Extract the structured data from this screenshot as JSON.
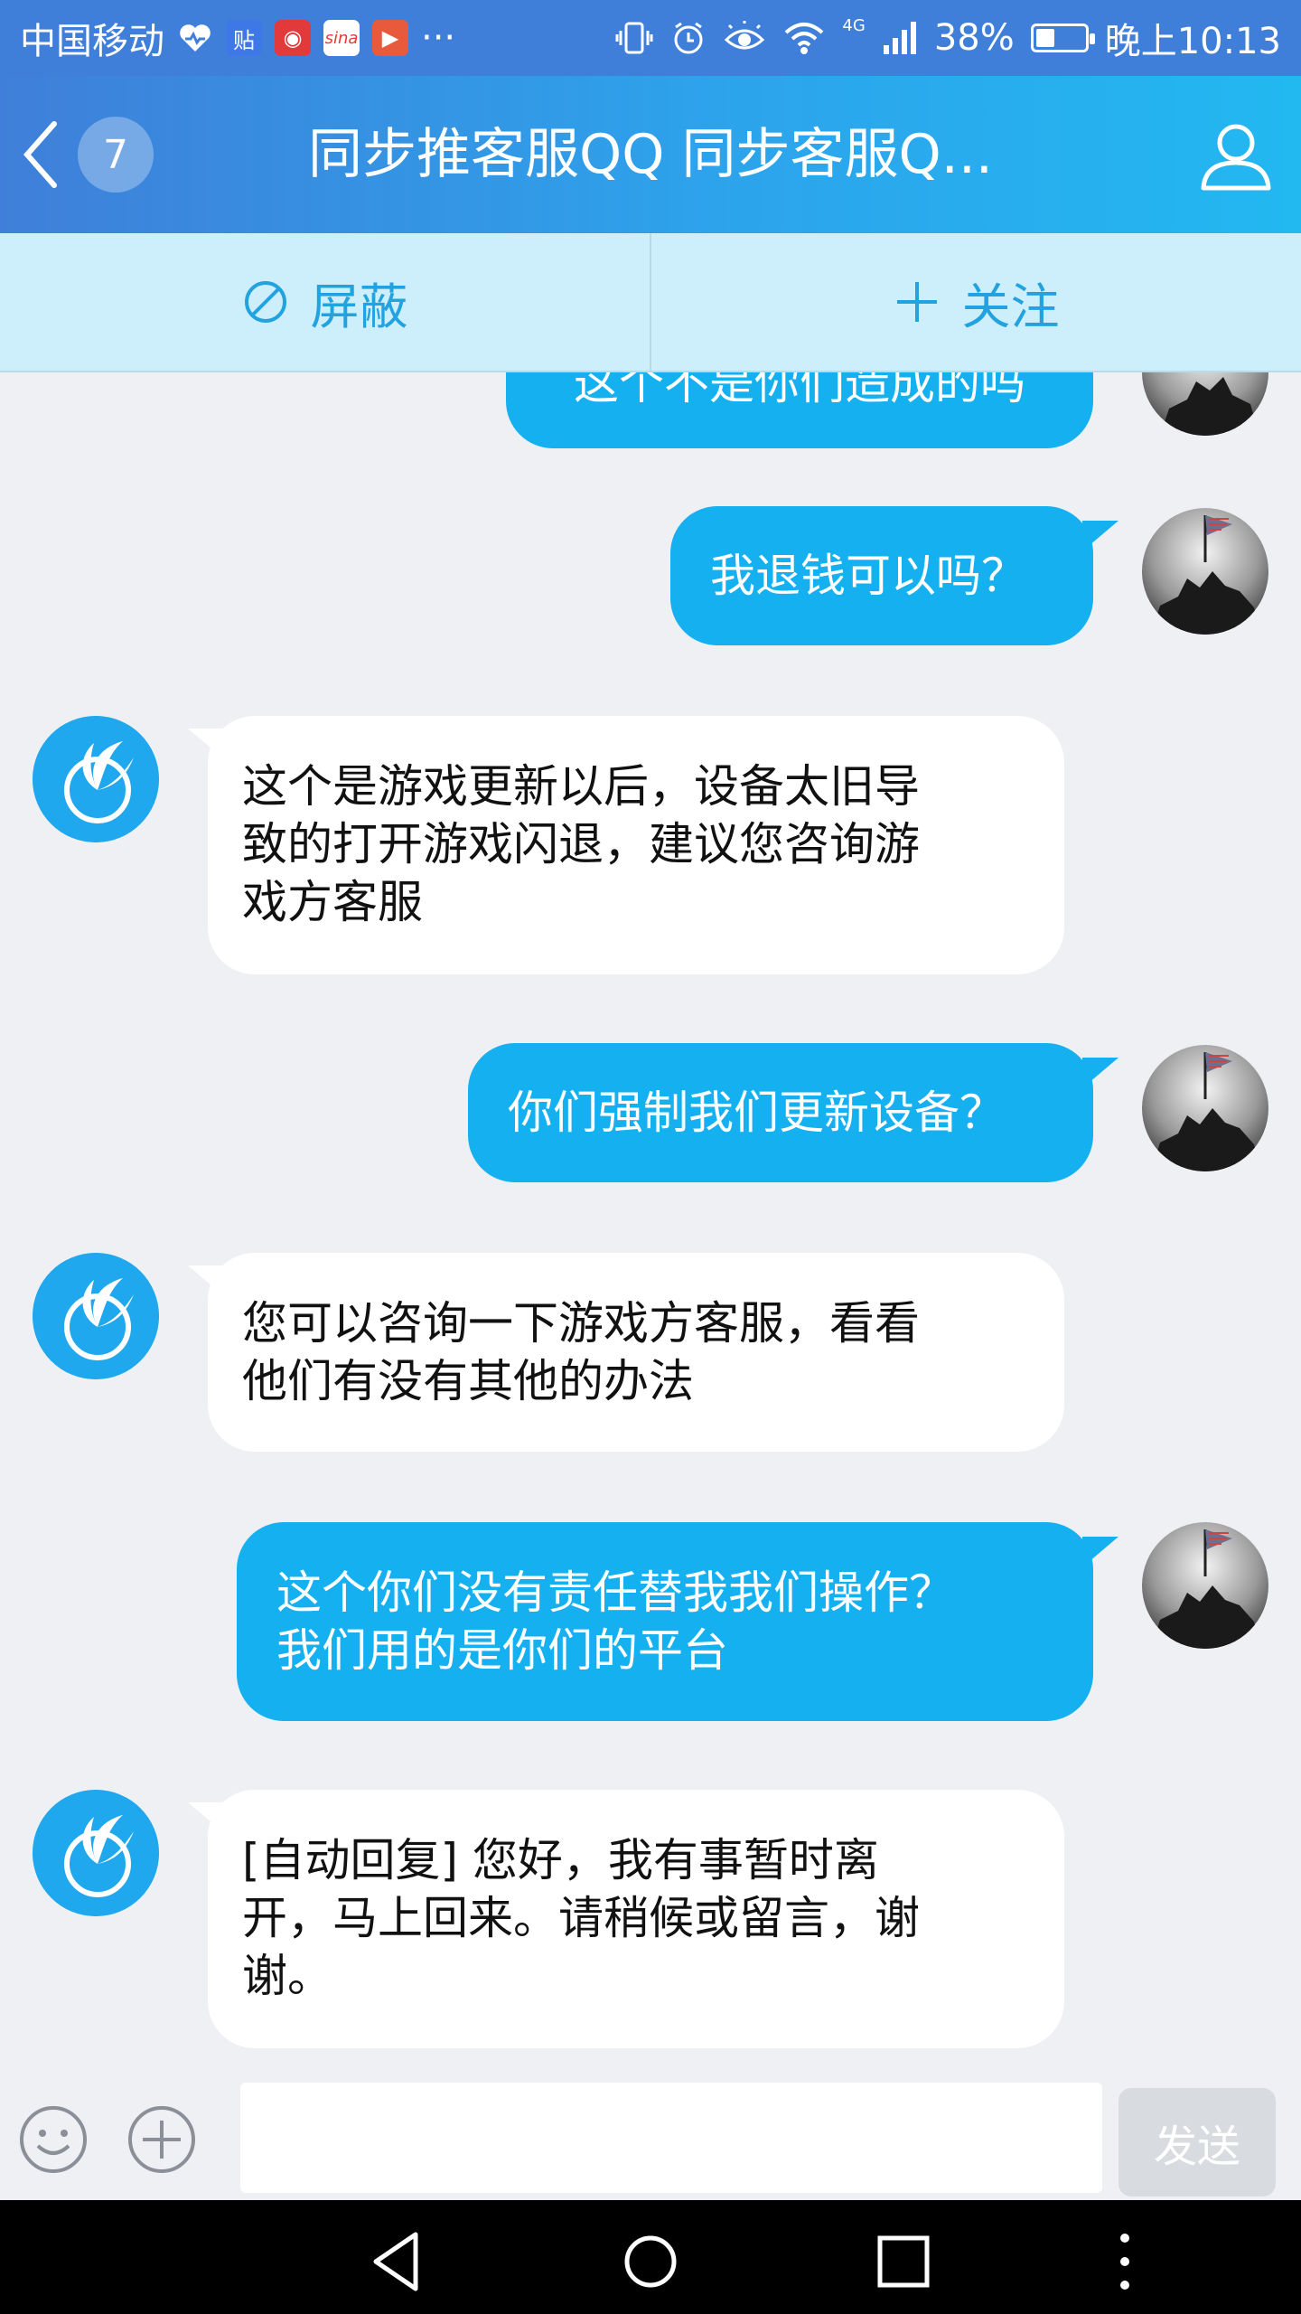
{
  "status_bar": {
    "carrier": "中国移动",
    "apps": [
      {
        "icon": "health-heart-icon",
        "text": "",
        "color": "transparent"
      },
      {
        "icon": "tieba-app-icon",
        "text": "贴",
        "color": "#3e78e6"
      },
      {
        "icon": "weibo-app-icon",
        "text": "◉",
        "color": "#e23a3a"
      },
      {
        "icon": "sina-app-icon",
        "text": "sina",
        "color": "#e63a2e"
      },
      {
        "icon": "video-app-icon",
        "text": "▶",
        "color": "#e85a3c"
      }
    ],
    "more": "···",
    "battery_percent": "38%",
    "battery_level": 0.38,
    "network": "4G",
    "time": "晚上10:13"
  },
  "header": {
    "unread_count": "7",
    "title": "同步推客服QQ 同步客服Q..."
  },
  "actions": {
    "block_label": "屏蔽",
    "follow_label": "关注"
  },
  "messages": [
    {
      "side": "out",
      "text": "这个不是你们造成的吗"
    },
    {
      "side": "out",
      "text": "我退钱可以吗？"
    },
    {
      "side": "in",
      "lines": [
        "这个是游戏更新以后，设备太旧导",
        "致的打开游戏闪退，建议您咨询游",
        "戏方客服"
      ]
    },
    {
      "side": "out",
      "text": "你们强制我们更新设备？"
    },
    {
      "side": "in",
      "lines": [
        "您可以咨询一下游戏方客服，看看",
        "他们有没有其他的办法"
      ]
    },
    {
      "side": "out",
      "lines": [
        "这个你们没有责任替我我们操作？",
        "我们用的是你们的平台"
      ]
    },
    {
      "side": "in",
      "lines": [
        "[自动回复] 您好，我有事暂时离",
        "开，马上回来。请稍候或留言，谢",
        "谢。"
      ]
    }
  ],
  "composer": {
    "value": "",
    "send_label": "发送"
  },
  "colors": {
    "outgoing_bubble": "#15b0f0",
    "incoming_bubble": "#ffffff",
    "header_start": "#3f7fd9",
    "header_end": "#22b8f0",
    "action_bar": "#cdeffb",
    "action_text": "#22a3df"
  }
}
